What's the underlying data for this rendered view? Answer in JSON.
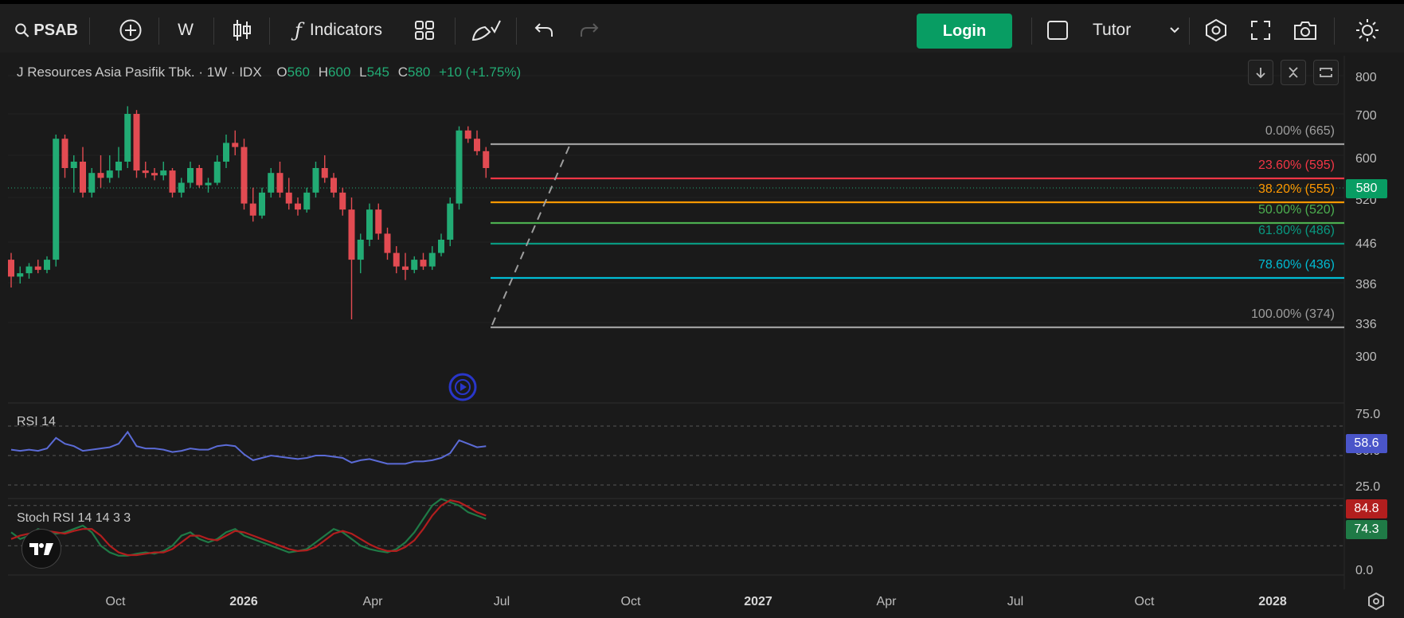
{
  "toolbar": {
    "symbol": "PSAB",
    "interval": "W",
    "indicators_label": "Indicators",
    "login_label": "Login",
    "layout_name": "Tutor"
  },
  "legend": {
    "title": "J Resources Asia Pasifik Tbk. · 1W · IDX",
    "o_label": "O",
    "o_value": "560",
    "h_label": "H",
    "h_value": "600",
    "l_label": "L",
    "l_value": "545",
    "c_label": "C",
    "c_value": "580",
    "change": "+10 (+1.75%)"
  },
  "price_axis": {
    "ticks": [
      "800",
      "700",
      "600",
      "520",
      "446",
      "386",
      "336",
      "300"
    ],
    "current_price": "580"
  },
  "fib_levels": [
    {
      "label": "0.00% (665)",
      "value": 665,
      "color": "#9e9e9e"
    },
    {
      "label": "23.60% (595)",
      "value": 595,
      "color": "#f23645"
    },
    {
      "label": "38.20% (555)",
      "value": 555,
      "color": "#ff9800"
    },
    {
      "label": "50.00% (520)",
      "value": 520,
      "color": "#4caf50"
    },
    {
      "label": "61.80% (486)",
      "value": 486,
      "color": "#089981"
    },
    {
      "label": "78.60% (436)",
      "value": 436,
      "color": "#00bcd4"
    },
    {
      "label": "100.00% (374)",
      "value": 374,
      "color": "#9e9e9e"
    }
  ],
  "rsi": {
    "label": "RSI 14",
    "value": "58.6",
    "axis": [
      "75.0",
      "50.0",
      "25.0"
    ],
    "color": "#5b6bd6"
  },
  "stoch": {
    "label": "Stoch RSI 14 14 3 3",
    "k_value": "84.8",
    "d_value": "74.3",
    "axis": [
      "0.0"
    ],
    "k_color": "#b21e1e",
    "d_color": "#1f7a46"
  },
  "time_axis": {
    "labels": [
      "Oct",
      "2026",
      "Apr",
      "Jul",
      "Oct",
      "2027",
      "Apr",
      "Jul",
      "Oct",
      "2028"
    ]
  },
  "chart_data": {
    "type": "candlestick",
    "title": "J Resources Asia Pasifik Tbk. · 1W · IDX",
    "ylim": [
      300,
      800
    ],
    "candles": [
      [
        420,
        430,
        380,
        395
      ],
      [
        395,
        410,
        385,
        400
      ],
      [
        400,
        415,
        392,
        410
      ],
      [
        410,
        420,
        400,
        405
      ],
      [
        405,
        425,
        400,
        420
      ],
      [
        420,
        650,
        410,
        640
      ],
      [
        640,
        650,
        560,
        580
      ],
      [
        580,
        600,
        530,
        590
      ],
      [
        590,
        620,
        520,
        530
      ],
      [
        530,
        580,
        520,
        570
      ],
      [
        570,
        600,
        540,
        560
      ],
      [
        560,
        600,
        550,
        575
      ],
      [
        575,
        620,
        560,
        590
      ],
      [
        590,
        720,
        580,
        700
      ],
      [
        700,
        710,
        560,
        575
      ],
      [
        575,
        590,
        560,
        570
      ],
      [
        570,
        580,
        555,
        565
      ],
      [
        565,
        590,
        555,
        575
      ],
      [
        575,
        580,
        520,
        530
      ],
      [
        530,
        560,
        520,
        550
      ],
      [
        550,
        590,
        540,
        580
      ],
      [
        580,
        585,
        540,
        545
      ],
      [
        545,
        560,
        530,
        550
      ],
      [
        550,
        600,
        545,
        590
      ],
      [
        590,
        650,
        580,
        630
      ],
      [
        630,
        660,
        600,
        620
      ],
      [
        620,
        640,
        500,
        510
      ],
      [
        510,
        540,
        480,
        490
      ],
      [
        490,
        540,
        485,
        530
      ],
      [
        530,
        580,
        520,
        570
      ],
      [
        570,
        590,
        520,
        530
      ],
      [
        530,
        560,
        500,
        510
      ],
      [
        510,
        520,
        490,
        500
      ],
      [
        500,
        540,
        495,
        530
      ],
      [
        530,
        590,
        520,
        580
      ],
      [
        580,
        600,
        550,
        560
      ],
      [
        560,
        570,
        520,
        530
      ],
      [
        530,
        540,
        490,
        500
      ],
      [
        500,
        520,
        340,
        420
      ],
      [
        420,
        460,
        400,
        450
      ],
      [
        450,
        510,
        440,
        500
      ],
      [
        500,
        510,
        450,
        460
      ],
      [
        460,
        470,
        420,
        430
      ],
      [
        430,
        440,
        400,
        410
      ],
      [
        410,
        430,
        390,
        405
      ],
      [
        405,
        425,
        400,
        420
      ],
      [
        420,
        430,
        405,
        410
      ],
      [
        410,
        440,
        405,
        430
      ],
      [
        430,
        460,
        425,
        450
      ],
      [
        450,
        520,
        440,
        510
      ],
      [
        510,
        670,
        500,
        660
      ],
      [
        660,
        670,
        630,
        640
      ],
      [
        640,
        660,
        600,
        610
      ],
      [
        610,
        620,
        560,
        580
      ]
    ]
  }
}
